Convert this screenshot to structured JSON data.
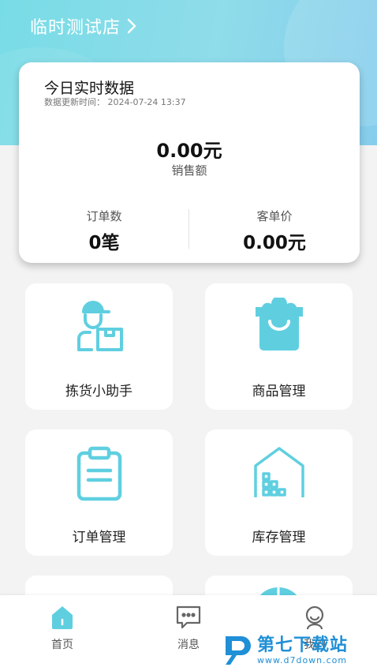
{
  "header": {
    "store_name": "临时测试店",
    "chevron_icon": "chevron-right-icon"
  },
  "stats": {
    "title": "今日实时数据",
    "updated": "数据更新时间： 2024-07-24 13:37",
    "sales_value": "0.00元",
    "sales_label": "销售额",
    "orders_label": "订单数",
    "orders_value": "0笔",
    "avg_label": "客单价",
    "avg_value": "0.00元"
  },
  "tiles": [
    {
      "label": "拣货小助手",
      "icon": "picker-worker-icon"
    },
    {
      "label": "商品管理",
      "icon": "shopping-bag-icon"
    },
    {
      "label": "订单管理",
      "icon": "clipboard-icon"
    },
    {
      "label": "库存管理",
      "icon": "warehouse-icon"
    }
  ],
  "nav": [
    {
      "label": "首页",
      "icon": "home-icon",
      "active": true
    },
    {
      "label": "消息",
      "icon": "message-icon",
      "active": false
    },
    {
      "label": "我的",
      "icon": "user-icon",
      "active": false
    }
  ],
  "watermark": {
    "cn": "第七下载站",
    "url": "www.d7down.com"
  },
  "colors": {
    "accent": "#5fcfe0",
    "header_gradient_start": "#78dce6",
    "header_gradient_end": "#86cdec",
    "watermark": "#1f8fd6"
  }
}
